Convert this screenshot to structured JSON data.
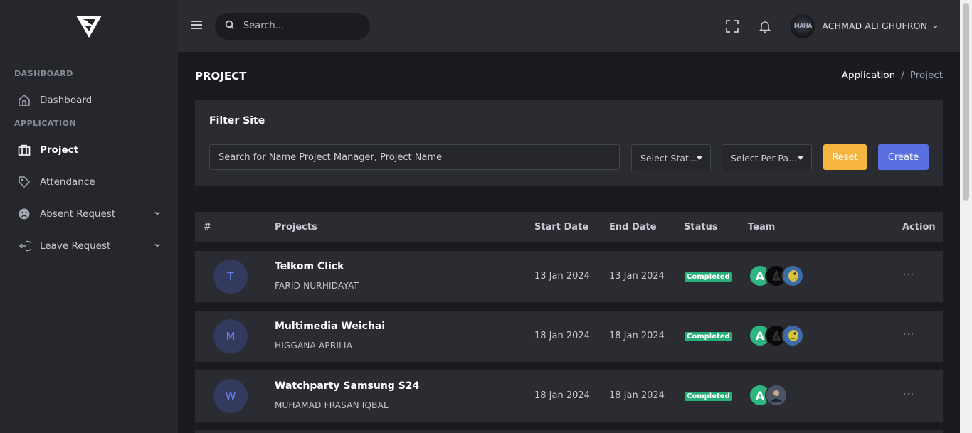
{
  "sidebar": {
    "sections": [
      {
        "label": "DASHBOARD",
        "items": [
          {
            "label": "Dashboard",
            "icon": "home-icon"
          }
        ]
      },
      {
        "label": "APPLICATION",
        "items": [
          {
            "label": "Project",
            "icon": "briefcase-icon",
            "active": true
          },
          {
            "label": "Attendance",
            "icon": "tag-icon"
          },
          {
            "label": "Absent Request",
            "icon": "sad-face-icon",
            "expandable": true
          },
          {
            "label": "Leave Request",
            "icon": "logout-icon",
            "expandable": true
          }
        ]
      }
    ]
  },
  "topbar": {
    "search_placeholder": "Search...",
    "user_name": "ACHMAD ALI GHUFRON",
    "avatar_text": "MAHA"
  },
  "page": {
    "title": "PROJECT",
    "breadcrumb": [
      "Application",
      "Project"
    ]
  },
  "filter": {
    "title": "Filter Site",
    "search_placeholder": "Search for Name Project Manager, Project Name",
    "status_select": "Select Stat...",
    "per_page_select": "Select Per Pa...",
    "reset_label": "Reset",
    "create_label": "Create"
  },
  "table": {
    "headers": [
      "#",
      "Projects",
      "Start Date",
      "End Date",
      "Status",
      "Team",
      "Action"
    ],
    "rows": [
      {
        "initial": "T",
        "project": "Telkom Click",
        "manager": "FARID NURHIDAYAT",
        "start": "13 Jan 2024",
        "end": "13 Jan 2024",
        "status": "Completed",
        "team": [
          "A",
          "",
          ""
        ],
        "action": "···"
      },
      {
        "initial": "M",
        "project": "Multimedia Weichai",
        "manager": "HIGGANA APRILIA",
        "start": "18 Jan 2024",
        "end": "18 Jan 2024",
        "status": "Completed",
        "team": [
          "A",
          "",
          ""
        ],
        "action": "···"
      },
      {
        "initial": "W",
        "project": "Watchparty Samsung S24",
        "manager": "MUHAMAD FRASAN IQBAL",
        "start": "18 Jan 2024",
        "end": "18 Jan 2024",
        "status": "Completed",
        "team": [
          "A",
          ""
        ],
        "action": "···"
      }
    ]
  },
  "colors": {
    "accent": "#5a6fe0",
    "warning": "#f5b53f",
    "success": "#27b07a"
  }
}
